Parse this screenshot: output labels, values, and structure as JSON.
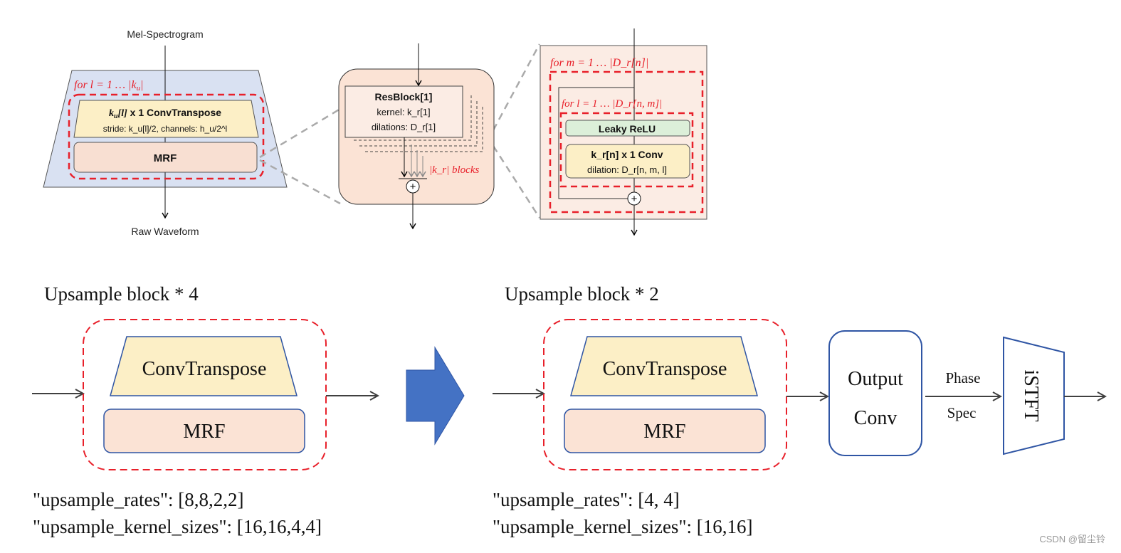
{
  "top_diagram": {
    "generator": {
      "input_label": "Mel-Spectrogram",
      "output_label": "Raw Waveform",
      "loop_label": "for  l = 1  … |k",
      "loop_sub": "u",
      "loop_end": "|",
      "convtranspose_title_math": "k",
      "convtranspose_title_sub": "u",
      "convtranspose_title_idx": "[l]",
      "convtranspose_title_rest": " x 1  ConvTranspose",
      "convtranspose_detail": "stride: k_u[l]/2, channels: h_u/2^l",
      "mrf_label": "MRF"
    },
    "mrf_detail": {
      "resblock_title": "ResBlock[1]",
      "kernel_label": "kernel: k_r[1]",
      "dilations_label": "dilations: D_r[1]",
      "blocks_label": "|k_r| blocks",
      "sum_symbol": "+"
    },
    "resblock_detail": {
      "outer_loop_label": "for  m = 1  … |D_r[n]|",
      "inner_loop_label": "for  l = 1  … |D_r[n, m]|",
      "activation_label": "Leaky ReLU",
      "conv_title": "k_r[n] x 1  Conv",
      "conv_detail": "dilation: D_r[n, m, l]",
      "sum_symbol": "+"
    }
  },
  "bottom_diagram": {
    "stage1": {
      "title": "Upsample block * 4",
      "convtranspose_label": "ConvTranspose",
      "mrf_label": "MRF",
      "config_rates": "\"upsample_rates\": [8,8,2,2]",
      "config_kernels": "\"upsample_kernel_sizes\": [16,16,4,4]"
    },
    "stage2": {
      "title": "Upsample block * 2",
      "convtranspose_label": "ConvTranspose",
      "mrf_label": "MRF",
      "config_rates": "\"upsample_rates\": [4, 4]",
      "config_kernels": "\"upsample_kernel_sizes\": [16,16]"
    },
    "output_conv": {
      "line1": "Output",
      "line2": "Conv"
    },
    "phase_label": "Phase",
    "spec_label": "Spec",
    "istft_label": "iSTFT"
  },
  "watermark": "CSDN @留尘铃",
  "colors": {
    "red_dash": "#e8202a",
    "blue_trap": "#d9e1f2",
    "yellow": "#fcefc6",
    "peach": "#f8dfd2",
    "green": "#dcefd9",
    "blue_line": "#2f55a4",
    "blue_arrow": "#4472c4",
    "mrf_bg": "#fbe3d5",
    "res_bg": "#fbece4"
  }
}
